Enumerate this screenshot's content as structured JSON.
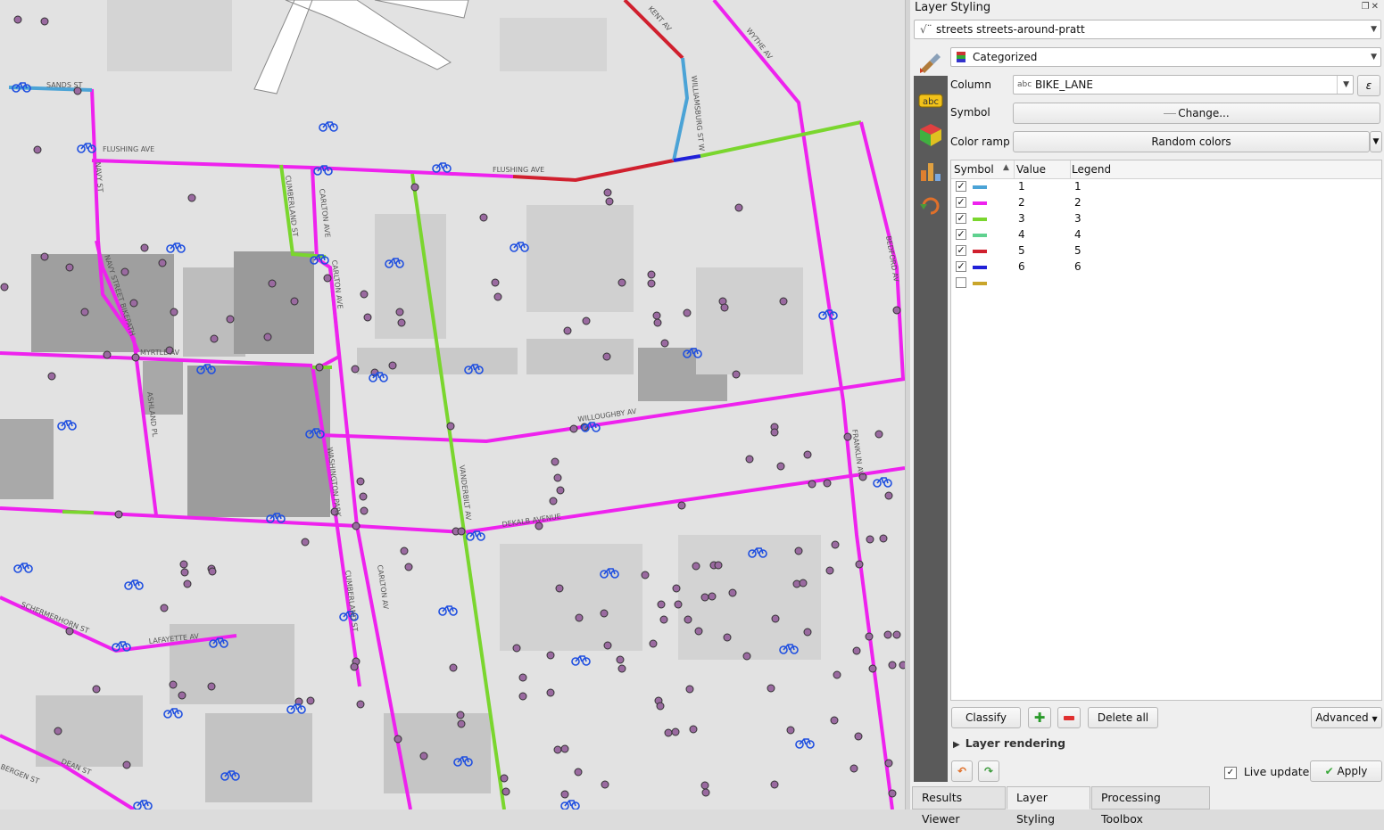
{
  "map": {
    "street_labels": [
      "SANDS ST",
      "FLUSHING AVE",
      "FLUSHING AVE",
      "NAVY ST",
      "CUMBERLAND ST",
      "CARLTON AVE",
      "CARLTON AVE",
      "NAVY STREET BIKEPATH",
      "MYRTLE AV",
      "ASHLAND PL",
      "WASHINGTON PARK",
      "VANDERBILT AV",
      "WILLOUGHBY AV",
      "DEKALB AVENUE",
      "CUMBERLAND ST",
      "CARLTON AV",
      "FRANKLIN AV",
      "BEDFORD AV",
      "KENT AV",
      "WILLIAMSBURG ST W",
      "WYTHE AV",
      "SCHERMERHORN ST",
      "LAFAYETTE AV",
      "DEAN ST",
      "BERGEN ST"
    ]
  },
  "panel": {
    "title": "Layer Styling",
    "layer_combo": "streets streets-around-pratt",
    "renderer": "Categorized",
    "column_label": "Column",
    "column_type": "abc",
    "column_value": "BIKE_LANE",
    "symbol_label": "Symbol",
    "symbol_button": "Change...",
    "color_ramp_label": "Color ramp",
    "color_ramp_value": "Random colors",
    "headers": {
      "symbol": "Symbol",
      "value": "Value",
      "legend": "Legend"
    },
    "rows": [
      {
        "checked": "✓",
        "color": "#4ba3d6",
        "value": "1",
        "legend": "1"
      },
      {
        "checked": "✓",
        "color": "#ee22ee",
        "value": "2",
        "legend": "2"
      },
      {
        "checked": "✓",
        "color": "#7ad62e",
        "value": "3",
        "legend": "3"
      },
      {
        "checked": "✓",
        "color": "#5fd18f",
        "value": "4",
        "legend": "4"
      },
      {
        "checked": "✓",
        "color": "#d0202e",
        "value": "5",
        "legend": "5"
      },
      {
        "checked": "✓",
        "color": "#2020d8",
        "value": "6",
        "legend": "6"
      },
      {
        "checked": "",
        "color": "#c9a52a",
        "value": "",
        "legend": ""
      }
    ],
    "classify": "Classify",
    "delete_all": "Delete all",
    "advanced": "Advanced",
    "layer_rendering": "Layer rendering",
    "live_update": "Live update",
    "apply": "Apply"
  },
  "tabs": [
    "Results Viewer",
    "Layer Styling",
    "Processing Toolbox"
  ]
}
